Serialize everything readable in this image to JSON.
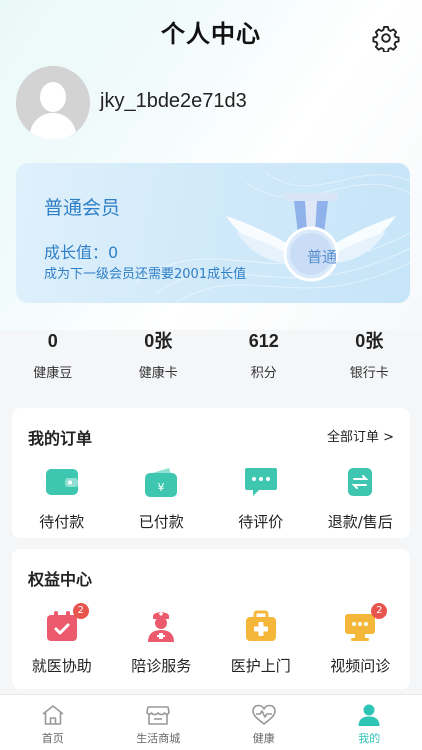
{
  "header": {
    "title": "个人中心"
  },
  "profile": {
    "username": "jky_1bde2e71d3"
  },
  "member_card": {
    "level": "普通会员",
    "growth_value": "成长值：0",
    "growth_hint": "成为下一级会员还需要2001成长值",
    "badge_text": "普通"
  },
  "stats": [
    {
      "value": "0",
      "label": "健康豆"
    },
    {
      "value": "0张",
      "label": "健康卡"
    },
    {
      "value": "612",
      "label": "积分"
    },
    {
      "value": "0张",
      "label": "银行卡"
    }
  ],
  "orders": {
    "title": "我的订单",
    "all_link": "全部订单 >",
    "items": [
      {
        "label": "待付款",
        "icon": "wallet-icon"
      },
      {
        "label": "已付款",
        "icon": "paid-icon"
      },
      {
        "label": "待评价",
        "icon": "comment-icon"
      },
      {
        "label": "退款/售后",
        "icon": "refund-icon"
      }
    ]
  },
  "rights": {
    "title": "权益中心",
    "items": [
      {
        "label": "就医协助",
        "icon": "calendar-check-icon",
        "badge": "2"
      },
      {
        "label": "陪诊服务",
        "icon": "nurse-icon"
      },
      {
        "label": "医护上门",
        "icon": "medical-kit-icon"
      },
      {
        "label": "视频问诊",
        "icon": "video-consult-icon",
        "badge": "2"
      }
    ]
  },
  "tabbar": [
    {
      "label": "首页",
      "icon": "home-icon"
    },
    {
      "label": "生活商城",
      "icon": "shop-icon"
    },
    {
      "label": "健康",
      "icon": "heart-pulse-icon"
    },
    {
      "label": "我的",
      "icon": "user-icon",
      "active": true
    }
  ],
  "colors": {
    "accent": "#2ec4b6",
    "member_text": "#2f7fc6",
    "order_icon": "#3ec6b0",
    "badge_red": "#e8544e"
  }
}
